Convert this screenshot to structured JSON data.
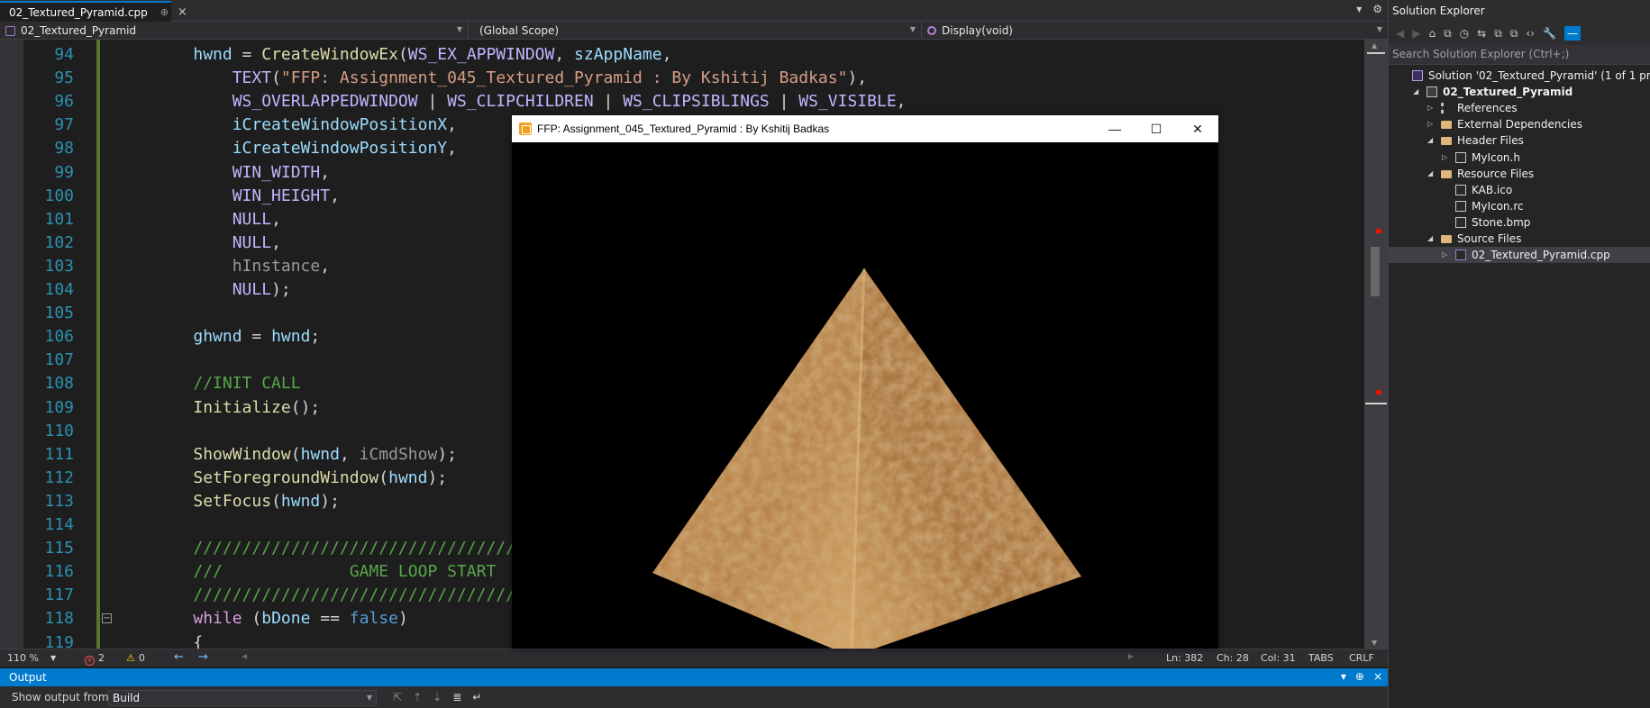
{
  "editor": {
    "tab": {
      "title": "02_Textured_Pyramid.cpp",
      "pin": "⊕",
      "close": "×"
    },
    "tab_right_icons": [
      "▾",
      "⚙"
    ],
    "nav": {
      "project": "02_Textured_Pyramid",
      "scope": "(Global Scope)",
      "member": "Display(void)"
    },
    "lines": [
      {
        "n": "94",
        "tokens": [
          [
            "pl",
            "    "
          ],
          [
            "id",
            "hwnd"
          ],
          [
            "pl",
            " = "
          ],
          [
            "fn",
            "CreateWindowEx"
          ],
          [
            "pl",
            "("
          ],
          [
            "mac",
            "WS_EX_APPWINDOW"
          ],
          [
            "pl",
            ", "
          ],
          [
            "id",
            "szAppName"
          ],
          [
            "pl",
            ","
          ]
        ]
      },
      {
        "n": "95",
        "tokens": [
          [
            "pl",
            "        "
          ],
          [
            "mac",
            "TEXT"
          ],
          [
            "pl",
            "("
          ],
          [
            "str",
            "\"FFP: Assignment_045_Textured_Pyramid : By Kshitij Badkas\""
          ],
          [
            "pl",
            "),"
          ]
        ]
      },
      {
        "n": "96",
        "tokens": [
          [
            "pl",
            "        "
          ],
          [
            "mac",
            "WS_OVERLAPPEDWINDOW"
          ],
          [
            "pl",
            " | "
          ],
          [
            "mac",
            "WS_CLIPCHILDREN"
          ],
          [
            "pl",
            " | "
          ],
          [
            "mac",
            "WS_CLIPSIBLINGS"
          ],
          [
            "pl",
            " | "
          ],
          [
            "mac",
            "WS_VISIBLE"
          ],
          [
            "pl",
            ","
          ]
        ]
      },
      {
        "n": "97",
        "tokens": [
          [
            "pl",
            "        "
          ],
          [
            "id",
            "iCreateWindowPositionX"
          ],
          [
            "pl",
            ","
          ]
        ]
      },
      {
        "n": "98",
        "tokens": [
          [
            "pl",
            "        "
          ],
          [
            "id",
            "iCreateWindowPositionY"
          ],
          [
            "pl",
            ","
          ]
        ]
      },
      {
        "n": "99",
        "tokens": [
          [
            "pl",
            "        "
          ],
          [
            "mac",
            "WIN_WIDTH"
          ],
          [
            "pl",
            ","
          ]
        ]
      },
      {
        "n": "100",
        "tokens": [
          [
            "pl",
            "        "
          ],
          [
            "mac",
            "WIN_HEIGHT"
          ],
          [
            "pl",
            ","
          ]
        ]
      },
      {
        "n": "101",
        "tokens": [
          [
            "pl",
            "        "
          ],
          [
            "mac",
            "NULL"
          ],
          [
            "pl",
            ","
          ]
        ]
      },
      {
        "n": "102",
        "tokens": [
          [
            "pl",
            "        "
          ],
          [
            "mac",
            "NULL"
          ],
          [
            "pl",
            ","
          ]
        ]
      },
      {
        "n": "103",
        "tokens": [
          [
            "pl",
            "        "
          ],
          [
            "par",
            "hInstance"
          ],
          [
            "pl",
            ","
          ]
        ]
      },
      {
        "n": "104",
        "tokens": [
          [
            "pl",
            "        "
          ],
          [
            "mac",
            "NULL"
          ],
          [
            "pl",
            ");"
          ]
        ]
      },
      {
        "n": "105",
        "tokens": []
      },
      {
        "n": "106",
        "tokens": [
          [
            "pl",
            "    "
          ],
          [
            "id",
            "ghwnd"
          ],
          [
            "pl",
            " = "
          ],
          [
            "id",
            "hwnd"
          ],
          [
            "pl",
            ";"
          ]
        ]
      },
      {
        "n": "107",
        "tokens": []
      },
      {
        "n": "108",
        "tokens": [
          [
            "pl",
            "    "
          ],
          [
            "com",
            "//INIT CALL"
          ]
        ]
      },
      {
        "n": "109",
        "tokens": [
          [
            "pl",
            "    "
          ],
          [
            "fn",
            "Initialize"
          ],
          [
            "pl",
            "();"
          ]
        ]
      },
      {
        "n": "110",
        "tokens": []
      },
      {
        "n": "111",
        "tokens": [
          [
            "pl",
            "    "
          ],
          [
            "fn",
            "ShowWindow"
          ],
          [
            "pl",
            "("
          ],
          [
            "id",
            "hwnd"
          ],
          [
            "pl",
            ", "
          ],
          [
            "par",
            "iCmdShow"
          ],
          [
            "pl",
            ");"
          ]
        ]
      },
      {
        "n": "112",
        "tokens": [
          [
            "pl",
            "    "
          ],
          [
            "fn",
            "SetForegroundWindow"
          ],
          [
            "pl",
            "("
          ],
          [
            "id",
            "hwnd"
          ],
          [
            "pl",
            ");"
          ]
        ]
      },
      {
        "n": "113",
        "tokens": [
          [
            "pl",
            "    "
          ],
          [
            "fn",
            "SetFocus"
          ],
          [
            "pl",
            "("
          ],
          [
            "id",
            "hwnd"
          ],
          [
            "pl",
            ");"
          ]
        ]
      },
      {
        "n": "114",
        "tokens": []
      },
      {
        "n": "115",
        "tokens": [
          [
            "pl",
            "    "
          ],
          [
            "com",
            "//////////////////////////////////"
          ]
        ]
      },
      {
        "n": "116",
        "tokens": [
          [
            "pl",
            "    "
          ],
          [
            "com",
            "///             GAME LOOP START"
          ]
        ]
      },
      {
        "n": "117",
        "tokens": [
          [
            "pl",
            "    "
          ],
          [
            "com",
            "//////////////////////////////////"
          ]
        ]
      },
      {
        "n": "118",
        "tokens": [
          [
            "pl",
            "    "
          ],
          [
            "ctrl",
            "while"
          ],
          [
            "pl",
            " ("
          ],
          [
            "id",
            "bDone"
          ],
          [
            "pl",
            " == "
          ],
          [
            "kw",
            "false"
          ],
          [
            "pl",
            ")"
          ]
        ]
      },
      {
        "n": "119",
        "tokens": [
          [
            "pl",
            "    {"
          ]
        ]
      }
    ],
    "status": {
      "zoom": "110 %",
      "errors": "2",
      "warnings": "0",
      "ln": "Ln: 382",
      "ch": "Ch: 28",
      "col": "Col: 31",
      "tabs": "TABS",
      "eol": "CRLF"
    }
  },
  "output": {
    "title": "Output",
    "show_from_label": "Show output from:",
    "source": "Build",
    "header_icons": [
      "▾",
      "⊕",
      "×"
    ]
  },
  "app_window": {
    "title": "FFP: Assignment_045_Textured_Pyramid : By Kshitij Badkas",
    "minimize": "—",
    "maximize": "☐",
    "close": "✕"
  },
  "solution_explorer": {
    "title": "Solution Explorer",
    "search_placeholder": "Search Solution Explorer (Ctrl+;)",
    "toolbar_icons": [
      "◀",
      "▶",
      "⌂",
      "⧉",
      "◷",
      "⇆",
      "⧉",
      "⧉",
      "‹›",
      "🔧",
      "—"
    ],
    "tree": [
      {
        "label": "Solution '02_Textured_Pyramid' (1 of 1 project)",
        "depth": 0,
        "expander": "",
        "icon": "solution"
      },
      {
        "label": "02_Textured_Pyramid",
        "depth": 1,
        "expander": "◢",
        "icon": "project",
        "bold": true
      },
      {
        "label": "References",
        "depth": 2,
        "expander": "▷",
        "icon": "refs"
      },
      {
        "label": "External Dependencies",
        "depth": 2,
        "expander": "▷",
        "icon": "folder"
      },
      {
        "label": "Header Files",
        "depth": 2,
        "expander": "◢",
        "icon": "folder"
      },
      {
        "label": "MyIcon.h",
        "depth": 3,
        "expander": "▷",
        "icon": "file"
      },
      {
        "label": "Resource Files",
        "depth": 2,
        "expander": "◢",
        "icon": "folder"
      },
      {
        "label": "KAB.ico",
        "depth": 3,
        "expander": "",
        "icon": "img"
      },
      {
        "label": "MyIcon.rc",
        "depth": 3,
        "expander": "",
        "icon": "file"
      },
      {
        "label": "Stone.bmp",
        "depth": 3,
        "expander": "",
        "icon": "img"
      },
      {
        "label": "Source Files",
        "depth": 2,
        "expander": "◢",
        "icon": "folder"
      },
      {
        "label": "02_Textured_Pyramid.cpp",
        "depth": 3,
        "expander": "▷",
        "icon": "cpp",
        "selected": true
      }
    ]
  }
}
